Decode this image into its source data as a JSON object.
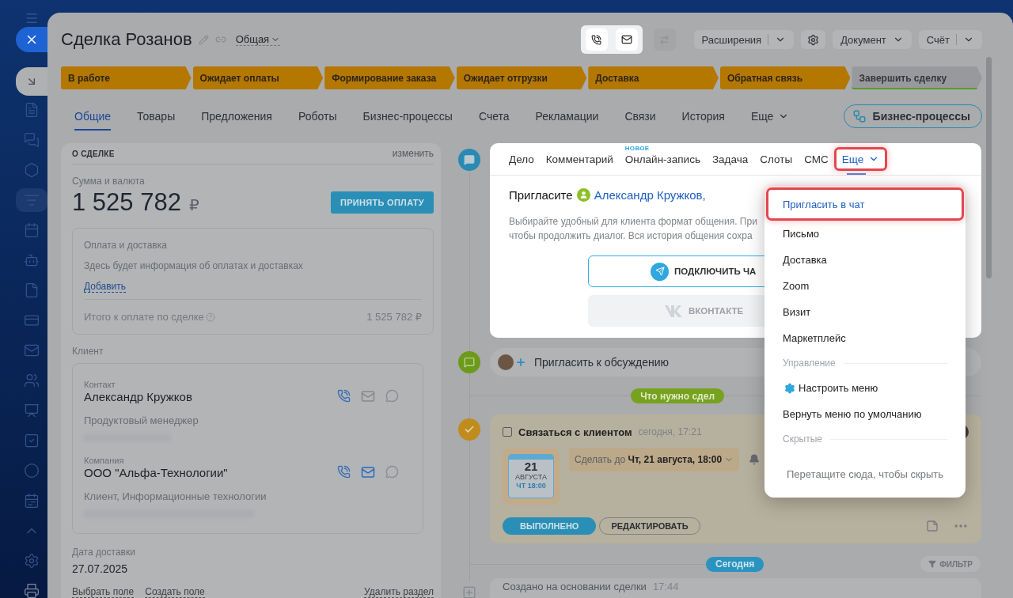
{
  "sidebar": {
    "items": [
      {
        "selected": false
      },
      {
        "selected": false
      },
      {
        "selected": false
      },
      {
        "selected": true
      },
      {
        "selected": false
      },
      {
        "selected": false
      },
      {
        "selected": false
      },
      {
        "selected": false
      },
      {
        "selected": false
      },
      {
        "selected": false
      },
      {
        "selected": false
      },
      {
        "selected": false
      },
      {
        "selected": false
      },
      {
        "selected": false
      },
      {
        "selected": false
      },
      {
        "selected": false
      },
      {
        "selected": false
      }
    ]
  },
  "header": {
    "title": "Сделка Розанов",
    "category": "Общая",
    "actions": [
      {
        "kind": "split",
        "label": "Расширения"
      },
      {
        "kind": "gear"
      },
      {
        "kind": "dropdown",
        "label": "Документ"
      },
      {
        "kind": "split",
        "label": "Счёт"
      }
    ]
  },
  "stages": [
    {
      "label": "В работе",
      "done": true
    },
    {
      "label": "Ожидает оплаты",
      "done": true
    },
    {
      "label": "Формирование заказа",
      "done": true
    },
    {
      "label": "Ожидает отгрузки",
      "done": true
    },
    {
      "label": "Доставка",
      "done": true
    },
    {
      "label": "Обратная связь",
      "done": true
    },
    {
      "label": "Завершить сделку",
      "done": false
    }
  ],
  "tabs": [
    {
      "label": "Общие",
      "selected": true,
      "kind": "tab"
    },
    {
      "label": "Товары",
      "selected": false,
      "kind": "tab"
    },
    {
      "label": "Предложения",
      "selected": false,
      "kind": "tab"
    },
    {
      "label": "Роботы",
      "selected": false,
      "kind": "tab"
    },
    {
      "label": "Бизнес-процессы",
      "selected": false,
      "kind": "tab"
    },
    {
      "label": "Счета",
      "selected": false,
      "kind": "tab"
    },
    {
      "label": "Рекламации",
      "selected": false,
      "kind": "tab"
    },
    {
      "label": "Связи",
      "selected": false,
      "kind": "tab"
    },
    {
      "label": "История",
      "selected": false,
      "kind": "tab"
    },
    {
      "label": "Еще",
      "selected": false,
      "kind": "more"
    }
  ],
  "process_button": "Бизнес-процессы",
  "deal": {
    "title": "О СДЕЛКЕ",
    "edit": "изменить",
    "amount_label": "Сумма и валюта",
    "amount": "1 525 782",
    "currency": "₽",
    "pay_button": "ПРИНЯТЬ ОПЛАТУ",
    "payment": {
      "title": "Оплата и доставка",
      "text": "Здесь будет информация об оплатах и доставках",
      "add": "Добавить",
      "total_label": "Итого к оплате по сделке",
      "total": "1 525 782 ₽"
    },
    "client_label": "Клиент",
    "clients": [
      {
        "role": "Контакт",
        "name": "Александр Кружков",
        "detail": "Продуктовый менеджер",
        "mail_active": false
      },
      {
        "role": "Компания",
        "name": "ООО \"Альфа-Технологии\"",
        "detail": "Клиент, Информационные технологии",
        "mail_active": true
      }
    ],
    "delivery_label": "Дата доставки",
    "delivery": "27.07.2025",
    "links": [
      "Выбрать поле",
      "Создать поле"
    ],
    "remove": "Удалить раздел"
  },
  "composer": {
    "tabs": [
      {
        "label": "Дело",
        "selected": false,
        "kind": "tab"
      },
      {
        "label": "Комментарий",
        "selected": false,
        "kind": "tab"
      },
      {
        "label": "Онлайн-запись",
        "selected": false,
        "kind": "tab",
        "badge": "НОВОЕ"
      },
      {
        "label": "Задача",
        "selected": false,
        "kind": "tab"
      },
      {
        "label": "Слоты",
        "selected": false,
        "kind": "tab"
      },
      {
        "label": "СМС",
        "selected": false,
        "kind": "tab"
      },
      {
        "label": "Еще",
        "selected": true,
        "kind": "more"
      }
    ],
    "invite": "Пригласите",
    "contact": "Александр Кружков,",
    "description": [
      "Выбирайте удобный для клиента формат общения. При",
      "чтобы продолжить диалог. Вся история общения сохра"
    ],
    "buttons": [
      {
        "kind": "telegram",
        "label": "ПОДКЛЮЧИТЬ ЧА",
        "disabled": false
      },
      {
        "kind": "vk",
        "label": "ВКОНТАКТЕ",
        "disabled": true
      }
    ]
  },
  "menu": {
    "items": [
      {
        "label": "Пригласить в чат",
        "selected": true
      },
      {
        "label": "Письмо",
        "selected": false
      },
      {
        "label": "Доставка",
        "selected": false
      },
      {
        "label": "Zoom",
        "selected": false
      },
      {
        "label": "Визит",
        "selected": false
      },
      {
        "label": "Маркетплейс",
        "selected": false
      }
    ],
    "manage_label": "Управление",
    "manage": [
      {
        "kind": "settings",
        "label": "Настроить меню"
      },
      {
        "kind": "plain",
        "label": "Вернуть меню по умолчанию"
      }
    ],
    "hidden_label": "Скрытые",
    "hidden_hint": "Перетащите сюда, чтобы скрыть"
  },
  "timeline": {
    "invite": "Пригласить к обсуждению",
    "todo_label": "Что нужно сдел",
    "task": {
      "done": false,
      "title": "Связаться с клиентом",
      "time": "сегодня, 17:21",
      "day": "21",
      "month": "АВГУСТА",
      "weekday_time": "ЧТ 18:00",
      "deadline": "Сделать до **Чт, 21 августа, 18:00**",
      "buttons": [
        "ВЫПОЛНЕНО",
        "РЕДАКТИРОВАТЬ"
      ]
    },
    "today": "Сегодня",
    "filter": "ФИЛЬТР",
    "entry_title": "Создано на основании сделки",
    "entry_time": "17:44"
  }
}
